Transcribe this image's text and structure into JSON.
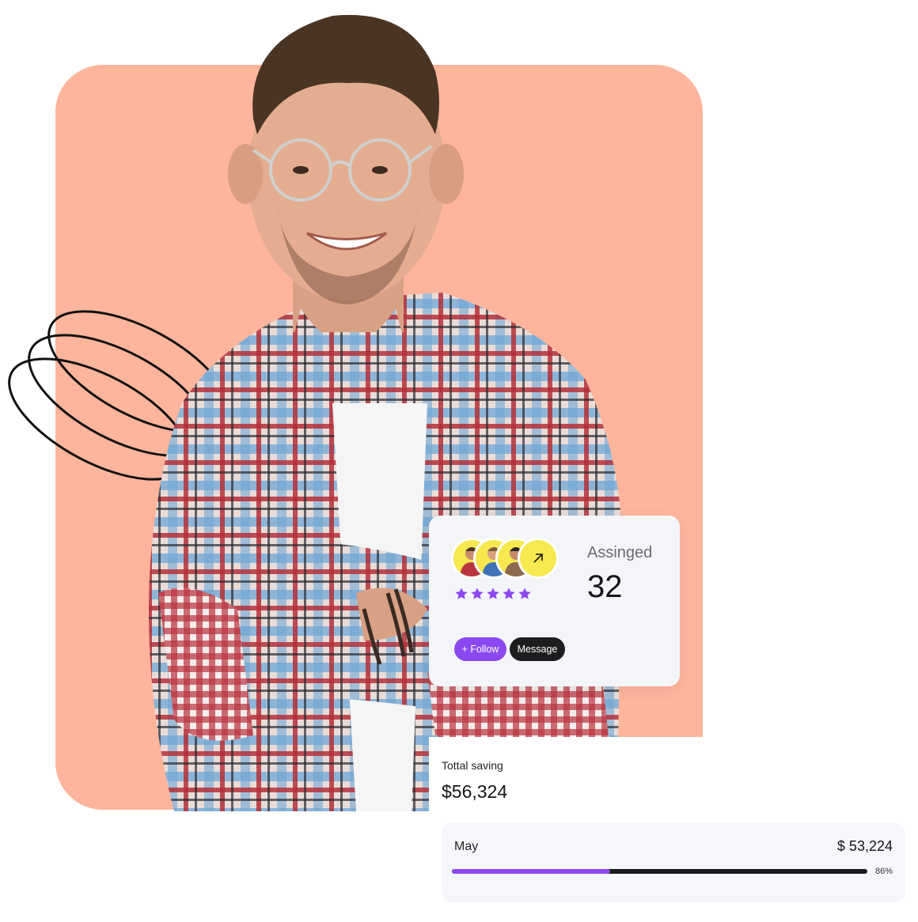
{
  "colors": {
    "background_card": "#ffb59c",
    "accent": "#8b48f0",
    "dark": "#1d1d20",
    "avatar_bg": "#f7e84f"
  },
  "profile_card": {
    "avatars": [
      "avatar-1",
      "avatar-2",
      "avatar-3"
    ],
    "arrow_icon": "arrow-up-right-icon",
    "rating": 5,
    "assigned_label": "Assinged",
    "assigned_value": "32",
    "follow_label": "+ Follow",
    "message_label": "Message"
  },
  "savings_card": {
    "label": "Tottal saving",
    "value": "$56,324",
    "month": "May",
    "month_amount": "$ 53,224",
    "progress_percent": 86,
    "progress_label": "86%"
  }
}
